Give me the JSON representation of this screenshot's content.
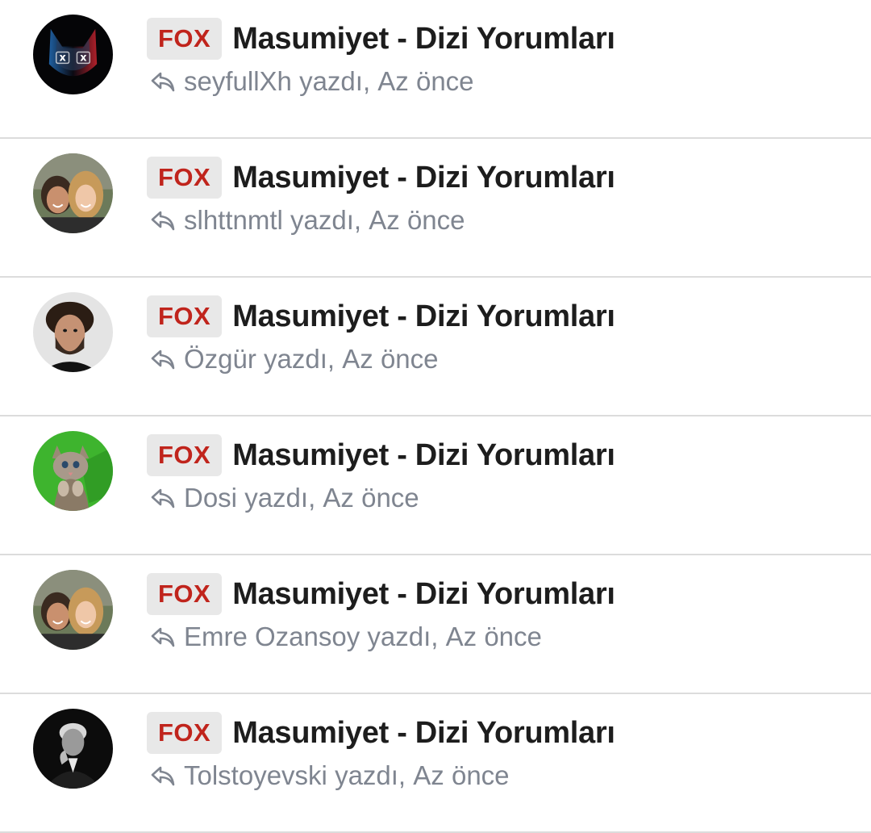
{
  "colors": {
    "badge_bg": "#e8e8e8",
    "badge_text": "#c0241c",
    "title": "#1d1d1d",
    "meta": "#7f8590",
    "divider": "#dcdcdc"
  },
  "threads": [
    {
      "prefix": "FOX",
      "title": "Masumiyet - Dizi Yorumları",
      "author": "seyfullXh",
      "action": "yazdı,",
      "time": "Az önce",
      "avatar": "cat-xx-eyes-avatar"
    },
    {
      "prefix": "FOX",
      "title": "Masumiyet - Dizi Yorumları",
      "author": "slhttnmtl",
      "action": "yazdı,",
      "time": "Az önce",
      "avatar": "couple-selfie-avatar"
    },
    {
      "prefix": "FOX",
      "title": "Masumiyet - Dizi Yorumları",
      "author": "Özgür",
      "action": "yazdı,",
      "time": "Az önce",
      "avatar": "bearded-man-avatar"
    },
    {
      "prefix": "FOX",
      "title": "Masumiyet - Dizi Yorumları",
      "author": "Dosi",
      "action": "yazdı,",
      "time": "Az önce",
      "avatar": "kitten-green-avatar"
    },
    {
      "prefix": "FOX",
      "title": "Masumiyet - Dizi Yorumları",
      "author": "Emre Ozansoy",
      "action": "yazdı,",
      "time": "Az önce",
      "avatar": "couple-selfie-avatar"
    },
    {
      "prefix": "FOX",
      "title": "Masumiyet - Dizi Yorumları",
      "author": "Tolstoyevski",
      "action": "yazdı,",
      "time": "Az önce",
      "avatar": "old-man-bw-avatar"
    }
  ]
}
